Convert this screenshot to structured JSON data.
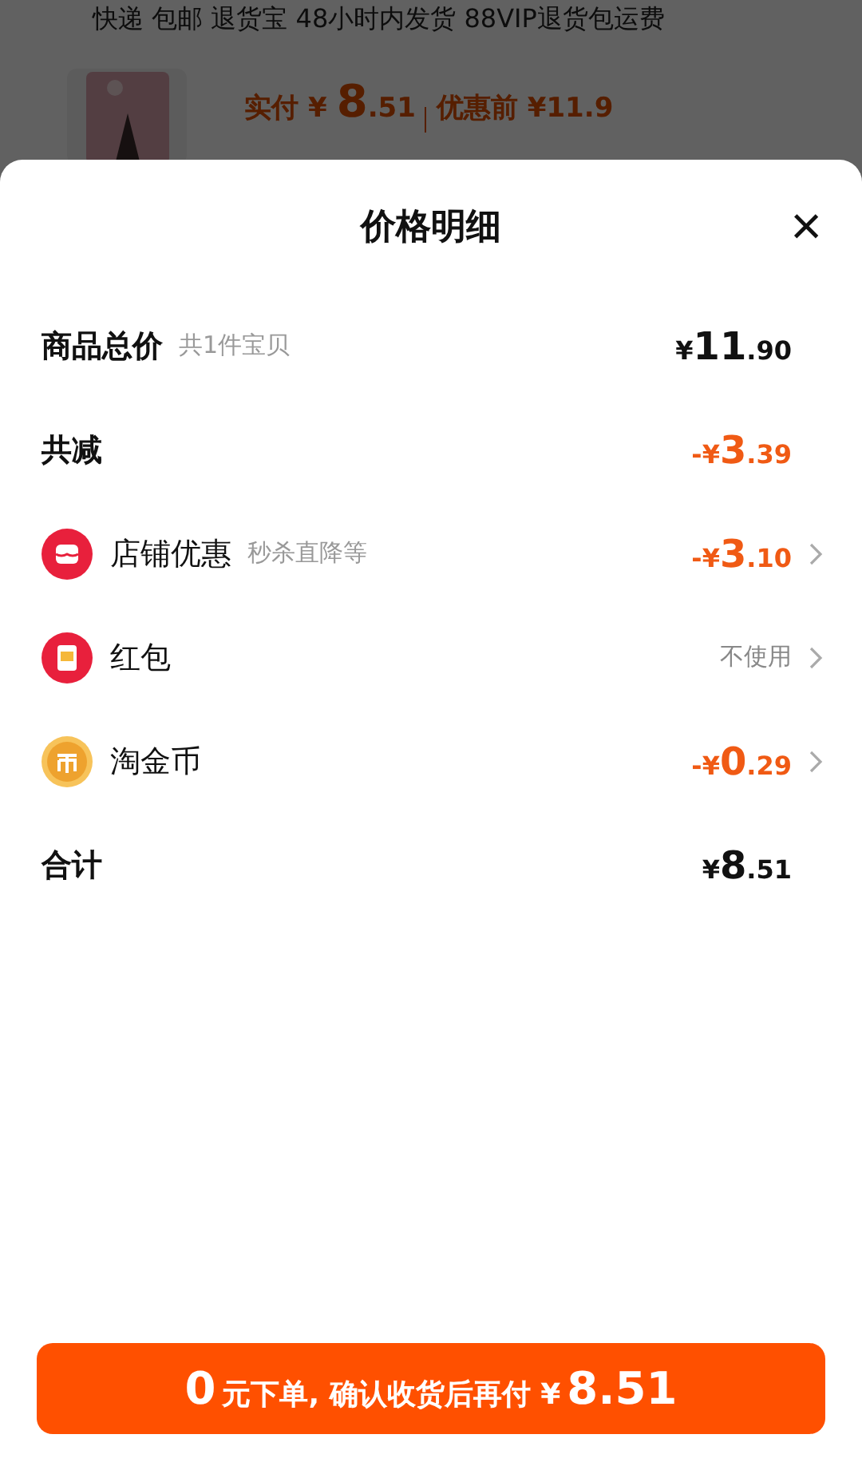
{
  "background": {
    "services": "快递 包邮 退货宝 48小时内发货 88VIP退货包运费",
    "product": {
      "kind": "picture",
      "paid_label": "实付",
      "paid_currency": "¥",
      "paid_main": "8",
      "paid_cents": ".51",
      "before_label": "优惠前",
      "before_price": "¥11.9"
    }
  },
  "sheet": {
    "title": "价格明细",
    "close": "×",
    "rows": [
      {
        "kind": "total",
        "label": "商品总价",
        "note": "共1件宝贝",
        "color": "#111111",
        "amount": {
          "prefix": "¥",
          "main": "11",
          "cents": ".90"
        },
        "chevron": false
      },
      {
        "kind": "total",
        "label": "共减",
        "color": "#f05a14",
        "amount": {
          "prefix": "-¥",
          "main": "3",
          "cents": ".39"
        },
        "chevron": false
      },
      {
        "kind": "shop",
        "label": "店铺优惠",
        "note": "秒杀直降等",
        "color": "#f05a14",
        "amount": {
          "prefix": "-¥",
          "main": "3",
          "cents": ".10"
        },
        "chevron": true
      },
      {
        "kind": "packet",
        "label": "红包",
        "color": "#888888",
        "value": "不使用",
        "chevron": true
      },
      {
        "kind": "coin",
        "label": "淘金币",
        "color": "#f05a14",
        "amount": {
          "prefix": "-¥",
          "main": "0",
          "cents": ".29"
        },
        "chevron": true
      },
      {
        "kind": "total",
        "label": "合计",
        "color": "#111111",
        "amount": {
          "prefix": "¥",
          "main": "8",
          "cents": ".51"
        },
        "chevron": false
      }
    ],
    "button": {
      "lead": "0",
      "middle": "元下单, 确认收货后再付 ¥",
      "amount": "8.51"
    }
  }
}
